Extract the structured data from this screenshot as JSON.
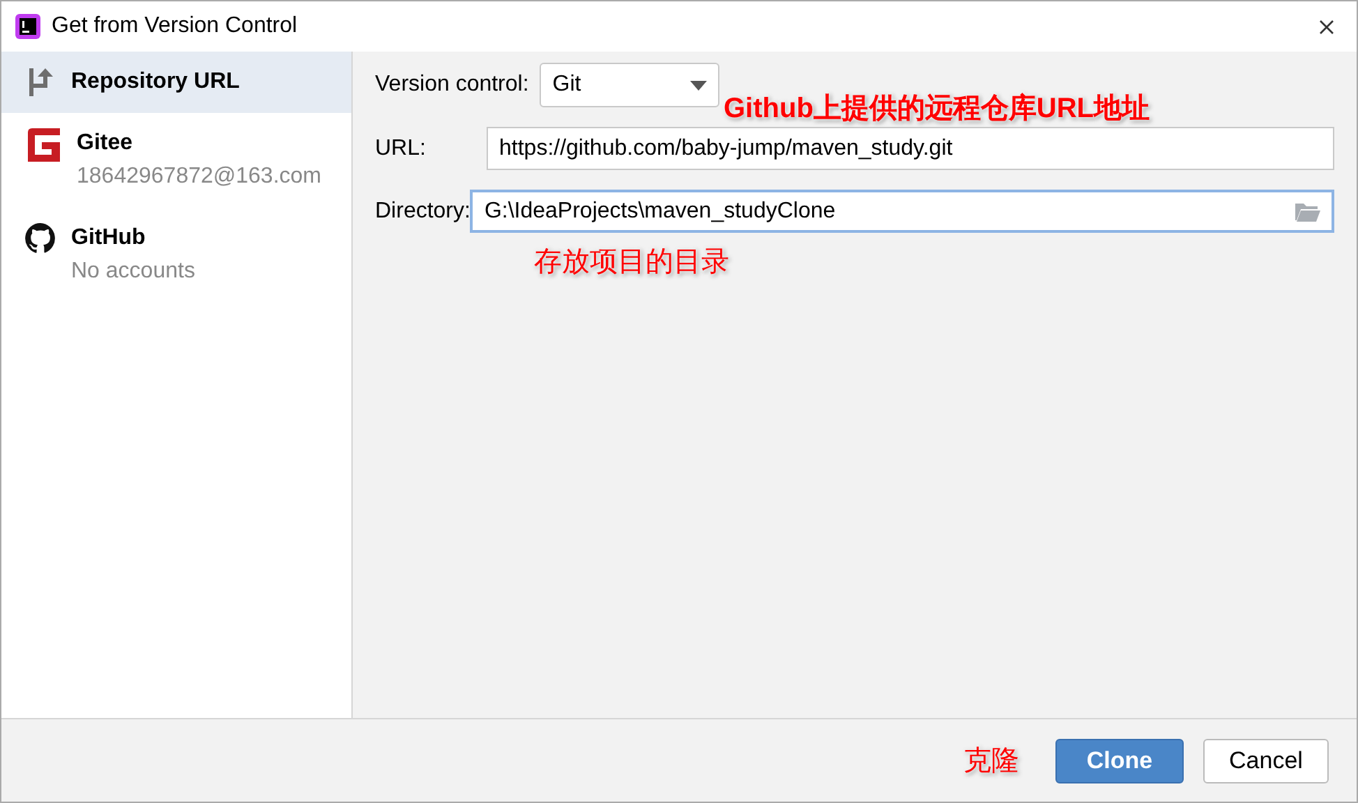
{
  "window": {
    "title": "Get from Version Control"
  },
  "sidebar": {
    "items": [
      {
        "kind": "url",
        "label": "Repository URL",
        "selected": true
      },
      {
        "kind": "gitee",
        "label": "Gitee",
        "subtitle": "18642967872@163.com",
        "selected": false
      },
      {
        "kind": "github",
        "label": "GitHub",
        "subtitle": "No accounts",
        "selected": false
      }
    ]
  },
  "form": {
    "version_control": {
      "label": "Version control:",
      "value": "Git"
    },
    "url": {
      "label": "URL:",
      "value": "https://github.com/baby-jump/maven_study.git",
      "focused": false
    },
    "directory": {
      "label": "Directory:",
      "value": "G:\\IdeaProjects\\maven_studyClone",
      "focused": true
    }
  },
  "annotations": [
    {
      "kind": "url-note",
      "text": "Github上提供的远程仓库URL地址"
    },
    {
      "kind": "dir-note",
      "text": "存放项目的目录"
    },
    {
      "kind": "clone-note",
      "text": "克隆"
    }
  ],
  "buttons": [
    {
      "label": "Clone",
      "kind": "primary"
    },
    {
      "label": "Cancel",
      "kind": "secondary"
    }
  ]
}
